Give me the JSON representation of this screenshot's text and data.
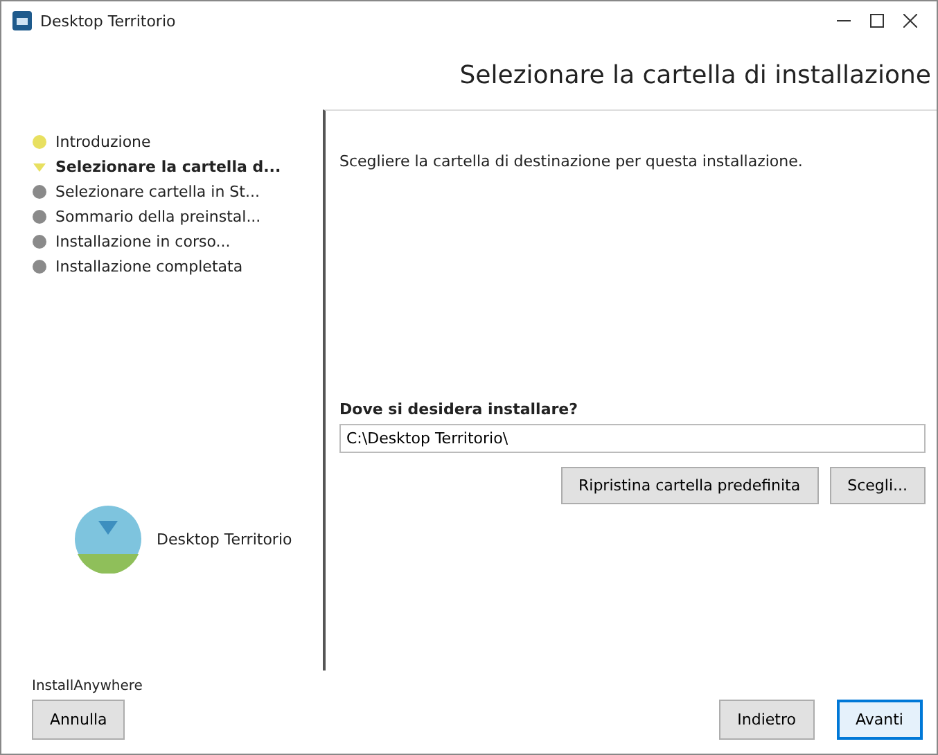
{
  "window": {
    "title": "Desktop Territorio"
  },
  "header": {
    "title": "Selezionare la cartella di installazione"
  },
  "steps": [
    {
      "label": "Introduzione",
      "done": true,
      "selected": false
    },
    {
      "label": "Selezionare la cartella d...",
      "done": true,
      "selected": true
    },
    {
      "label": "Selezionare cartella in St...",
      "done": false,
      "selected": false
    },
    {
      "label": "Sommario della preinstal...",
      "done": false,
      "selected": false
    },
    {
      "label": "Installazione in corso...",
      "done": false,
      "selected": false
    },
    {
      "label": "Installazione completata",
      "done": false,
      "selected": false
    }
  ],
  "logo": {
    "text": "Desktop Territorio"
  },
  "content": {
    "description": "Scegliere la cartella di destinazione per questa installazione.",
    "question": "Dove si desidera installare?",
    "path": "C:\\Desktop Territorio\\",
    "buttons": [
      "Ripristina cartella predefinita",
      "Scegli..."
    ]
  },
  "footer": {
    "brand": "InstallAnywhere",
    "cancel": "Annulla",
    "back": "Indietro",
    "next": "Avanti"
  }
}
